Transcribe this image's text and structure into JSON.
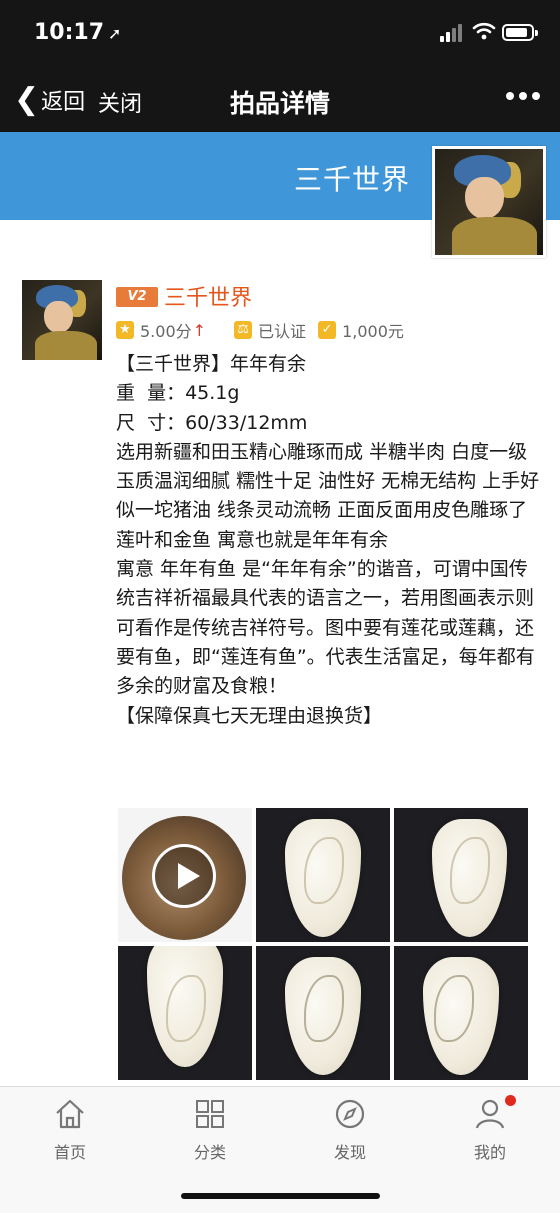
{
  "status_bar": {
    "time": "10:17",
    "location_arrow": "➚"
  },
  "navbar": {
    "back_label": "返回",
    "close_label": "关闭",
    "title": "拍品详情",
    "more_icon": "more-dots-icon"
  },
  "banner": {
    "shop_name": "三千世界",
    "color": "#3f97da"
  },
  "post": {
    "vip_label": "V2",
    "seller_name": "三千世界",
    "rating": "5.00分",
    "rating_trend": "↑",
    "verified": "已认证",
    "deposit": "1,000元",
    "lines": [
      "【三千世界】年年有余",
      "重  量：45.1g",
      "尺  寸：60/33/12mm",
      "选用新疆和田玉精心雕琢而成 半糖半肉 白度一级 玉质温润细腻 糯性十足 油性好 无棉无结构 上手好似一坨猪油 线条灵动流畅 正面反面用皮色雕琢了莲叶和金鱼 寓意也就是年年有余",
      "寓意 年年有鱼 是“年年有余”的谐音，可谓中国传统吉祥祈福最具代表的语言之一，若用图画表示则可看作是传统吉祥符号。图中要有莲花或莲藕，还要有鱼，即“莲连有鱼”。代表生活富足，每年都有多余的财富及食粮！",
      "【保障保真七天无理由退换货】"
    ]
  },
  "tabbar": {
    "items": [
      {
        "label": "首页",
        "icon": "home-icon"
      },
      {
        "label": "分类",
        "icon": "category-grid-icon"
      },
      {
        "label": "发现",
        "icon": "compass-icon"
      },
      {
        "label": "我的",
        "icon": "user-icon"
      }
    ]
  },
  "colors": {
    "accent_orange": "#e3571e",
    "nav_bg": "#151515",
    "badge_red": "#e02a1e"
  }
}
